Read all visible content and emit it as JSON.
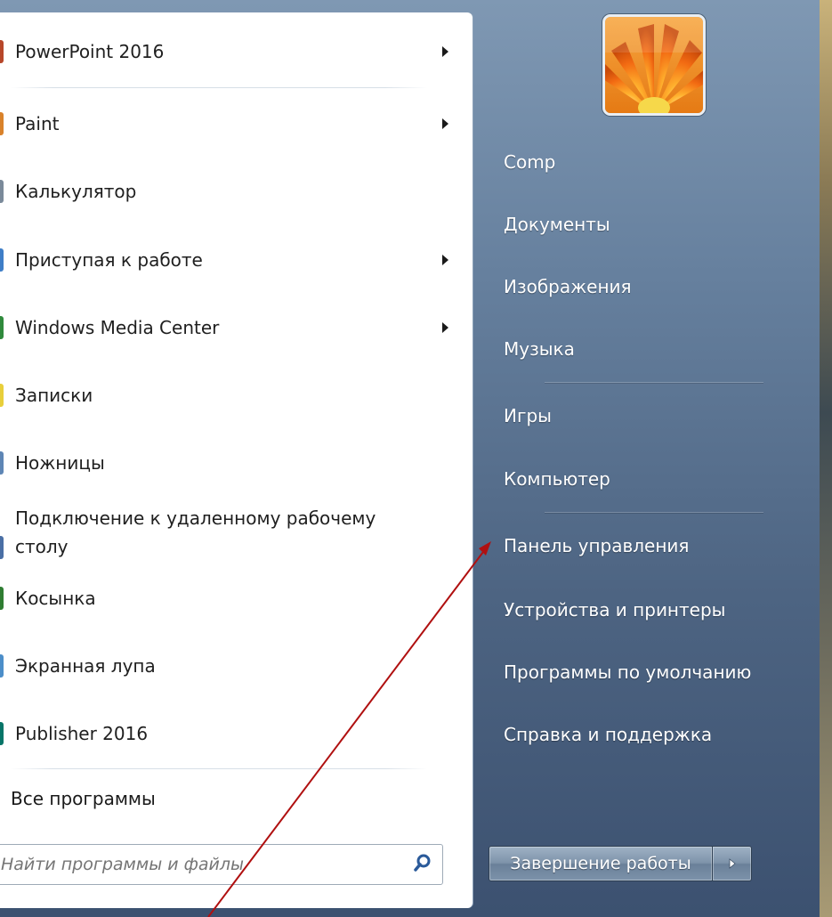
{
  "programs": [
    {
      "label": "PowerPoint 2016",
      "has_submenu": true,
      "icon": "powerpoint-icon",
      "color": "#b7472a"
    },
    {
      "label": "Paint",
      "has_submenu": true,
      "icon": "paint-icon",
      "color": "#d9822b"
    },
    {
      "label": "Калькулятор",
      "has_submenu": false,
      "icon": "calculator-icon",
      "color": "#7a8a9a"
    },
    {
      "label": "Приступая к работе",
      "has_submenu": true,
      "icon": "getting-started-icon",
      "color": "#3f7ec7"
    },
    {
      "label": "Windows Media Center",
      "has_submenu": true,
      "icon": "media-center-icon",
      "color": "#2f8a3c"
    },
    {
      "label": "Записки",
      "has_submenu": false,
      "icon": "sticky-notes-icon",
      "color": "#e8cf3b"
    },
    {
      "label": "Ножницы",
      "has_submenu": false,
      "icon": "snipping-tool-icon",
      "color": "#5e86b5"
    },
    {
      "label": "Подключение к удаленному рабочему",
      "label_line2": "столу",
      "has_submenu": false,
      "icon": "remote-desktop-icon",
      "color": "#4a6fa5"
    },
    {
      "label": "Косынка",
      "has_submenu": false,
      "icon": "solitaire-icon",
      "color": "#2f7d32"
    },
    {
      "label": "Экранная лупа",
      "has_submenu": false,
      "icon": "magnifier-icon",
      "color": "#4c8ec9"
    },
    {
      "label": "Publisher 2016",
      "has_submenu": false,
      "icon": "publisher-icon",
      "color": "#077568"
    }
  ],
  "all_programs_label": "Все программы",
  "search": {
    "placeholder": "Найти программы и файлы"
  },
  "right_menu": {
    "items": [
      "Comp",
      "Документы",
      "Изображения",
      "Музыка",
      "Игры",
      "Компьютер",
      "Панель управления",
      "Устройства и принтеры",
      "Программы по умолчанию",
      "Справка и поддержка"
    ]
  },
  "shutdown": {
    "label": "Завершение работы"
  },
  "colors": {
    "annotation_arrow": "#b01010"
  }
}
